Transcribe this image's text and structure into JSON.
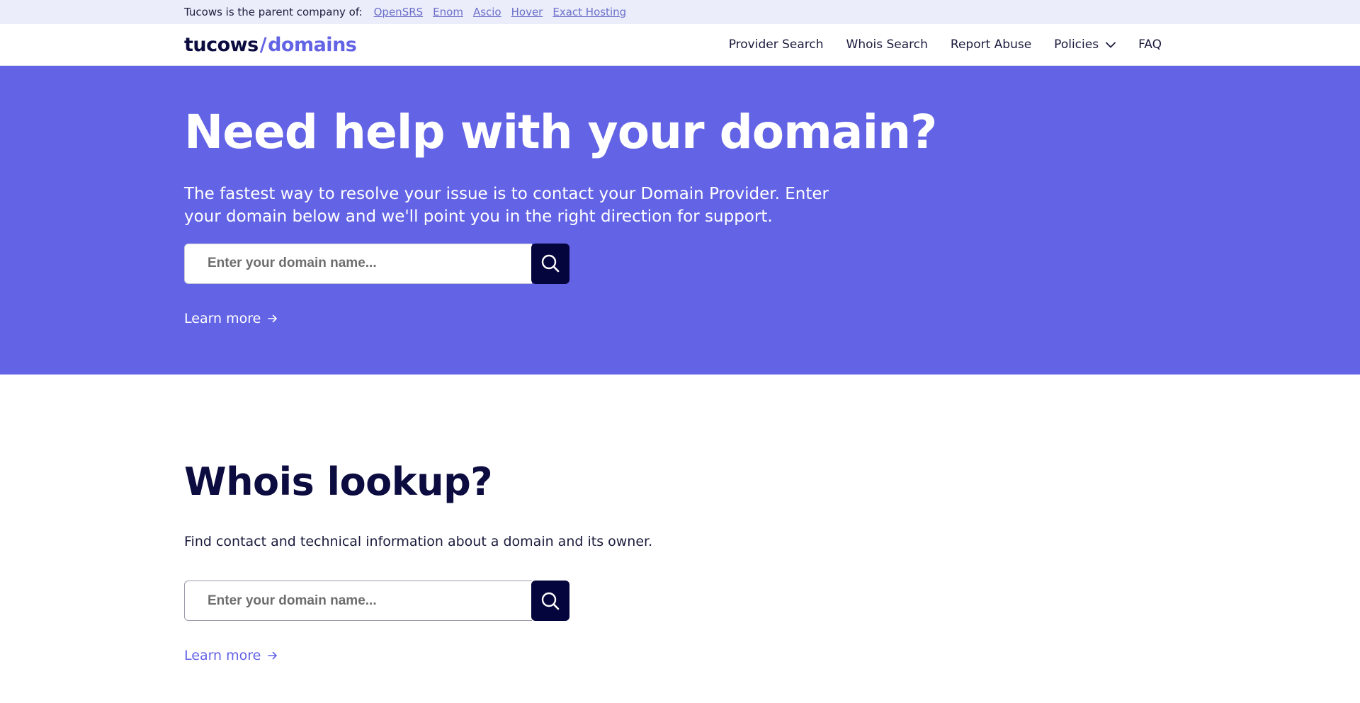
{
  "topbar": {
    "parent_text": "Tucows is the parent company of:",
    "links": [
      "OpenSRS",
      "Enom",
      "Ascio",
      "Hover",
      "Exact Hosting"
    ]
  },
  "header": {
    "logo_part1": "tucows",
    "logo_slash": "/",
    "logo_part2": "domains",
    "nav": [
      "Provider Search",
      "Whois Search",
      "Report Abuse",
      "Policies",
      "FAQ"
    ]
  },
  "hero": {
    "title": "Need help with your domain?",
    "subtitle": "The fastest way to resolve your issue is to contact your Domain Provider. Enter your domain below and we'll point you in the right direction for support.",
    "search_placeholder": "Enter your domain name...",
    "learn_more": "Learn more"
  },
  "whois": {
    "title": "Whois lookup?",
    "description": "Find contact and technical information about a domain and its owner.",
    "search_placeholder": "Enter your domain name...",
    "learn_more": "Learn more"
  },
  "colors": {
    "brand_purple": "#6363e6",
    "navy": "#05053d",
    "topbar_bg": "#ebedfb"
  }
}
